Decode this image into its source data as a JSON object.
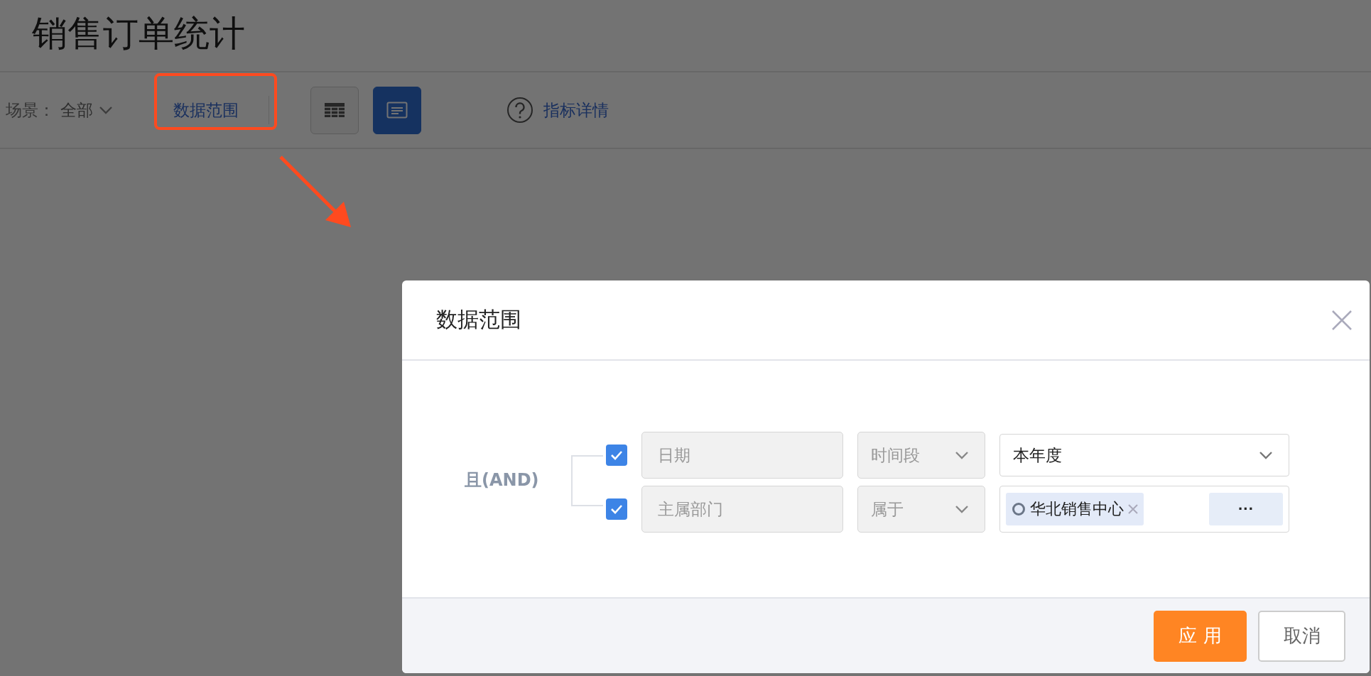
{
  "page": {
    "title": "销售订单统计",
    "toolbar": {
      "scene_label": "场景：",
      "scene_value": "全部",
      "data_range_link": "数据范围",
      "view_buttons": [
        {
          "kind": "table",
          "selected": false
        },
        {
          "kind": "text",
          "selected": true
        }
      ],
      "metric_details": "指标详情"
    }
  },
  "dialog": {
    "title": "数据范围",
    "logic": "且(AND)",
    "conditions": [
      {
        "checked": true,
        "field": "日期",
        "operator": "时间段",
        "kind": "select",
        "value": "本年度"
      },
      {
        "checked": true,
        "field": "主属部门",
        "operator": "属于",
        "kind": "tags",
        "tags": [
          "华北销售中心"
        ],
        "more": "···"
      }
    ],
    "buttons": [
      {
        "kind": "primary",
        "label": "应 用"
      },
      {
        "kind": "secondary",
        "label": "取消"
      }
    ]
  }
}
